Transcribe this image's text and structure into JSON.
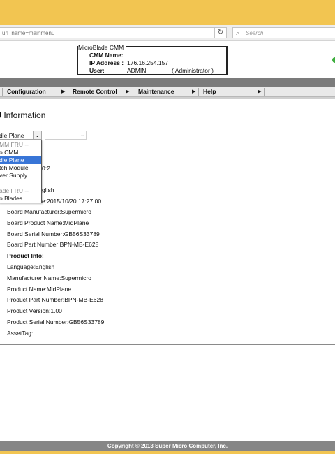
{
  "browser": {
    "url": "url_name=mainmenu",
    "search_placeholder": "Search",
    "reload_icon": "reload-icon",
    "search_icon": "magnifier-icon"
  },
  "cmm_info": {
    "title": "MicroBlade CMM",
    "name_label": "CMM Name:",
    "name_value": "",
    "ip_label": "IP Address :",
    "ip_value": "176.16.254.157",
    "user_label": "User:",
    "user_value": "ADMIN",
    "role_value": "( Administrator )",
    "status_color": "#3fae3f"
  },
  "menu": {
    "items": [
      {
        "label": "Configuration"
      },
      {
        "label": "Remote Control"
      },
      {
        "label": "Maintenance"
      },
      {
        "label": "Help"
      }
    ]
  },
  "page": {
    "title": "J Information",
    "select1_value": "dle Plane",
    "select2_value": ""
  },
  "dropdown": {
    "options": [
      {
        "label": "MM FRU --",
        "type": "group"
      },
      {
        "label": "o CMM",
        "type": "option"
      },
      {
        "label": "dle Plane",
        "type": "selected"
      },
      {
        "label": "tch Module",
        "type": "option"
      },
      {
        "label": "ver Supply",
        "type": "option"
      },
      {
        "label": "",
        "type": "blank"
      },
      {
        "label": "ade FRU --",
        "type": "group"
      },
      {
        "label": "o Blades",
        "type": "option"
      }
    ]
  },
  "fru": {
    "partial_version": "0:2",
    "partial_language": "glish",
    "partial_date": "e:2015/10/20 17:27:00",
    "rows": [
      {
        "text": "Board Manufacturer:Supermicro",
        "bold": false
      },
      {
        "text": "Board Product Name:MidPlane",
        "bold": false
      },
      {
        "text": "Board Serial Number:GB56S33789",
        "bold": false
      },
      {
        "text": "Board Part Number:BPN-MB-E628",
        "bold": false
      },
      {
        "text": "Product Info:",
        "bold": true
      },
      {
        "text": "Language:English",
        "bold": false
      },
      {
        "text": "Manufacturer Name:Supermicro",
        "bold": false
      },
      {
        "text": "Product Name:MidPlane",
        "bold": false
      },
      {
        "text": "Product Part Number:BPN-MB-E628",
        "bold": false
      },
      {
        "text": "Product Version:1.00",
        "bold": false
      },
      {
        "text": "Product Serial Number:GB56S33789",
        "bold": false
      },
      {
        "text": "AssetTag:",
        "bold": false
      }
    ]
  },
  "footer": {
    "copyright": "Copyright © 2013 Super Micro Computer, Inc."
  }
}
